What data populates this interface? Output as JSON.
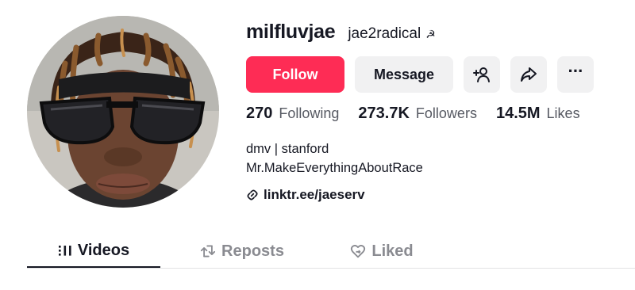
{
  "profile": {
    "username": "milfluvjae",
    "nickname": "jae2radical",
    "nickname_emoji": "☭",
    "bio_line1": "dmv | stanford",
    "bio_line2": "Mr.MakeEverythingAboutRace",
    "link": "linktr.ee/jaeserv"
  },
  "actions": {
    "follow_label": "Follow",
    "message_label": "Message",
    "icons": [
      "add-friend-icon",
      "share-icon",
      "more-icon"
    ],
    "more_glyph": "···"
  },
  "stats": [
    {
      "value": "270",
      "label": "Following"
    },
    {
      "value": "273.7K",
      "label": "Followers"
    },
    {
      "value": "14.5M",
      "label": "Likes"
    }
  ],
  "tabs": [
    {
      "label": "Videos",
      "active": true,
      "icon": "grid-icon"
    },
    {
      "label": "Reposts",
      "active": false,
      "icon": "repost-icon"
    },
    {
      "label": "Liked",
      "active": false,
      "icon": "liked-heart-icon"
    }
  ],
  "colors": {
    "accent": "#fe2c55",
    "text": "#161823",
    "secondary_text": "#565962",
    "inactive_tab": "#8a8b91",
    "button_bg": "#f1f1f2"
  }
}
